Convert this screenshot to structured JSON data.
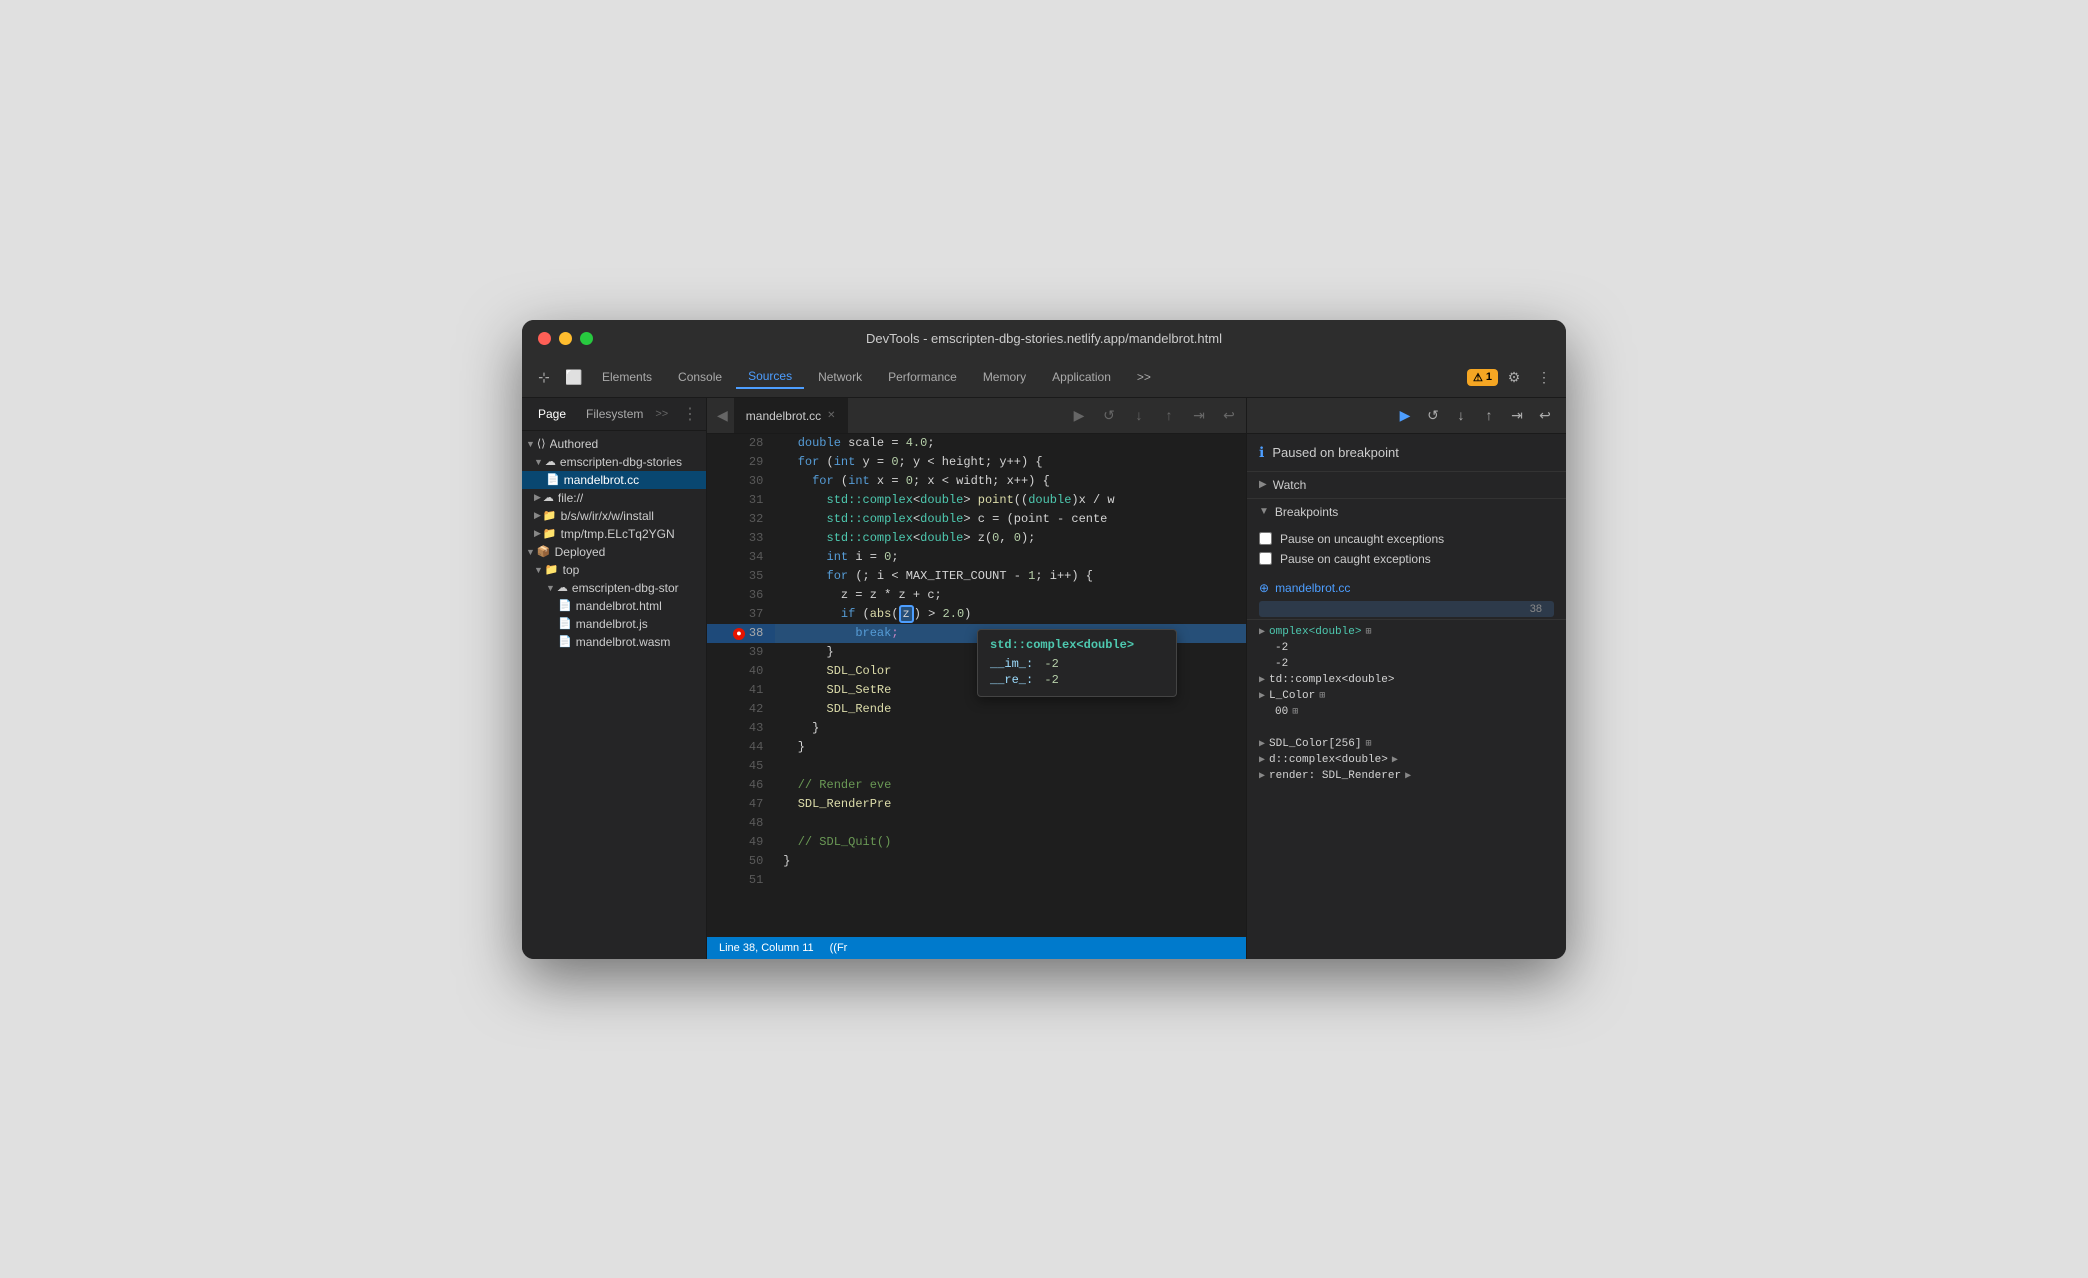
{
  "window": {
    "title": "DevTools - emscripten-dbg-stories.netlify.app/mandelbrot.html",
    "traffic_lights": [
      "red",
      "yellow",
      "green"
    ]
  },
  "toolbar": {
    "buttons": [
      {
        "label": "Elements",
        "active": false
      },
      {
        "label": "Console",
        "active": false
      },
      {
        "label": "Sources",
        "active": true
      },
      {
        "label": "Network",
        "active": false
      },
      {
        "label": "Performance",
        "active": false
      },
      {
        "label": "Memory",
        "active": false
      },
      {
        "label": "Application",
        "active": false
      }
    ],
    "more_label": ">>",
    "warning_count": "1",
    "settings_icon": "⚙",
    "more_icon": "⋮"
  },
  "sidebar": {
    "tabs": [
      {
        "label": "Page",
        "active": true
      },
      {
        "label": "Filesystem",
        "active": false
      }
    ],
    "more_label": ">>",
    "options_icon": "⋮",
    "tree": [
      {
        "level": 0,
        "type": "folder",
        "label": "<> Authored",
        "expanded": true,
        "icon": "◇"
      },
      {
        "level": 1,
        "type": "cloud",
        "label": "emscripten-dbg-stories",
        "expanded": true,
        "icon": "☁"
      },
      {
        "level": 2,
        "type": "file",
        "label": "mandelbrot.cc",
        "selected": true,
        "icon": "📄"
      },
      {
        "level": 1,
        "type": "cloud",
        "label": "file://",
        "expanded": false,
        "icon": "☁"
      },
      {
        "level": 1,
        "type": "folder",
        "label": "b/s/w/ir/x/w/install",
        "expanded": false,
        "icon": "📁"
      },
      {
        "level": 1,
        "type": "folder",
        "label": "tmp/tmp.ELcTq2YGN",
        "expanded": false,
        "icon": "📁"
      },
      {
        "level": 0,
        "type": "folder",
        "label": "Deployed",
        "expanded": true,
        "icon": "📦"
      },
      {
        "level": 1,
        "type": "folder",
        "label": "top",
        "expanded": true,
        "icon": "📁"
      },
      {
        "level": 2,
        "type": "cloud",
        "label": "emscripten-dbg-stor",
        "expanded": true,
        "icon": "☁"
      },
      {
        "level": 3,
        "type": "file",
        "label": "mandelbrot.html",
        "icon": "📄"
      },
      {
        "level": 3,
        "type": "file",
        "label": "mandelbrot.js",
        "icon": "📄"
      },
      {
        "level": 3,
        "type": "file",
        "label": "mandelbrot.wasm",
        "icon": "📄"
      }
    ]
  },
  "editor": {
    "tab_label": "mandelbrot.cc",
    "lines": [
      {
        "num": 28,
        "code": "  double scale = 4.0;",
        "highlight": false
      },
      {
        "num": 29,
        "code": "  for (int y = 0; y < height; y++) {",
        "highlight": false
      },
      {
        "num": 30,
        "code": "    for (int x = 0; x < width; x++) {",
        "highlight": false
      },
      {
        "num": 31,
        "code": "      std::complex<double> point((double)x / w",
        "highlight": false
      },
      {
        "num": 32,
        "code": "      std::complex<double> c = (point - cente",
        "highlight": false
      },
      {
        "num": 33,
        "code": "      std::complex<double> z(0, 0);",
        "highlight": false
      },
      {
        "num": 34,
        "code": "      int i = 0;",
        "highlight": false
      },
      {
        "num": 35,
        "code": "      for (; i < MAX_ITER_COUNT - 1; i++) {",
        "highlight": false
      },
      {
        "num": 36,
        "code": "        z = z * z + c;",
        "highlight": false
      },
      {
        "num": 37,
        "code": "        if (abs([z]) > 2.0)",
        "highlight": false,
        "has_highlight_box": true
      },
      {
        "num": 38,
        "code": "          break;",
        "highlight": true,
        "breakpoint": true
      },
      {
        "num": 39,
        "code": "    }",
        "highlight": false
      },
      {
        "num": 40,
        "code": "    SDL_Color",
        "highlight": false
      },
      {
        "num": 41,
        "code": "    SDL_SetRe",
        "highlight": false
      },
      {
        "num": 42,
        "code": "    SDL_Rende",
        "highlight": false
      },
      {
        "num": 43,
        "code": "  }",
        "highlight": false
      },
      {
        "num": 44,
        "code": "}",
        "highlight": false
      },
      {
        "num": 45,
        "code": "",
        "highlight": false
      },
      {
        "num": 46,
        "code": "  // Render eve",
        "highlight": false
      },
      {
        "num": 47,
        "code": "  SDL_RenderPre",
        "highlight": false
      },
      {
        "num": 48,
        "code": "",
        "highlight": false
      },
      {
        "num": 49,
        "code": "  // SDL_Quit()",
        "highlight": false
      },
      {
        "num": 50,
        "code": "}",
        "highlight": false
      },
      {
        "num": 51,
        "code": "",
        "highlight": false
      }
    ],
    "tooltip": {
      "title": "std::complex<double>",
      "fields": [
        {
          "key": "__im_:",
          "val": "-2"
        },
        {
          "key": "__re_:",
          "val": "-2"
        }
      ]
    },
    "status": {
      "line": "38",
      "col": "11",
      "context": "(Fr"
    }
  },
  "debugger": {
    "buttons": [
      {
        "icon": "▶",
        "label": "resume",
        "active": true
      },
      {
        "icon": "↺",
        "label": "step-over"
      },
      {
        "icon": "↓",
        "label": "step-into"
      },
      {
        "icon": "↑",
        "label": "step-out"
      },
      {
        "icon": "⇥",
        "label": "step"
      },
      {
        "icon": "⤶",
        "label": "deactivate"
      }
    ],
    "paused_message": "Paused on breakpoint",
    "sections": {
      "watch": {
        "label": "Watch",
        "expanded": false
      },
      "breakpoints": {
        "label": "Breakpoints",
        "expanded": true,
        "pause_uncaught": "Pause on uncaught exceptions",
        "pause_caught": "Pause on caught exceptions",
        "file": "mandelbrot.cc",
        "line": "38"
      }
    },
    "scope_items": [
      {
        "key": "",
        "val": "omplex<double>",
        "icon": "▶",
        "type": "type"
      },
      {
        "key": "-2",
        "val": "",
        "icon": ""
      },
      {
        "key": "-2",
        "val": "",
        "icon": ""
      },
      {
        "key": "",
        "val": "td::complex<double>",
        "icon": "▶"
      },
      {
        "key": "",
        "val": "L_Color",
        "icon": "▶"
      },
      {
        "key": "00",
        "val": "",
        "icon": ""
      },
      {
        "key": "",
        "val": "",
        "icon": ""
      },
      {
        "key": "",
        "val": "SDL_Color[256]",
        "icon": "▶"
      },
      {
        "key": "",
        "val": "d::complex<double>",
        "icon": "▶"
      },
      {
        "key": "",
        "val": "render: SDL_Renderer",
        "icon": "▶"
      }
    ]
  }
}
